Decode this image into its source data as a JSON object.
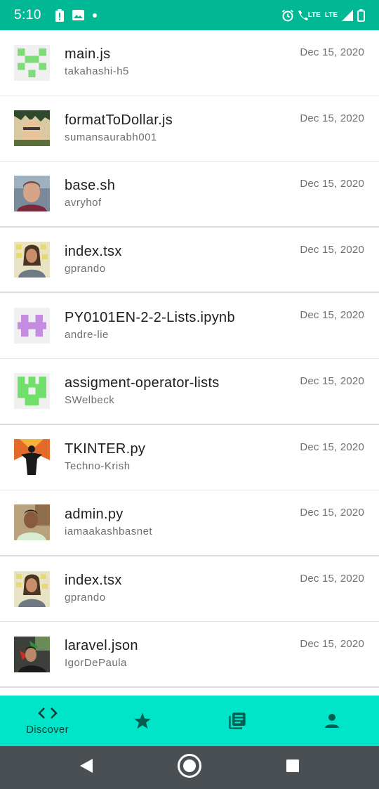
{
  "status_bar": {
    "time": "5:10",
    "left_icons": [
      "battery-alert-icon",
      "image-icon",
      "dot-icon"
    ],
    "right_icons": [
      "alarm-icon",
      "wifi-calling-lte-icon",
      "lte-icon",
      "signal-icon",
      "battery-icon"
    ],
    "lte_label": "LTE",
    "lte_label_2": "LTE"
  },
  "gists": [
    {
      "file": "main.js",
      "user": "takahashi-h5",
      "date": "Dec 15, 2020",
      "avatar": "identicon-green-x"
    },
    {
      "file": "formatToDollar.js",
      "user": "sumansaurabh001",
      "date": "Dec 15, 2020",
      "avatar": "photo-anime"
    },
    {
      "file": "base.sh",
      "user": "avryhof",
      "date": "Dec 15, 2020",
      "avatar": "photo-man"
    },
    {
      "file": "index.tsx",
      "user": "gprando",
      "date": "Dec 15, 2020",
      "avatar": "photo-longhair"
    },
    {
      "file": "PY0101EN-2-2-Lists.ipynb",
      "user": "andre-lie",
      "date": "Dec 15, 2020",
      "avatar": "identicon-purple"
    },
    {
      "file": "assigment-operator-lists",
      "user": "SWelbeck",
      "date": "Dec 15, 2020",
      "avatar": "identicon-green-block"
    },
    {
      "file": "TKINTER.py",
      "user": "Techno-Krish",
      "date": "Dec 15, 2020",
      "avatar": "photo-silhouette"
    },
    {
      "file": "admin.py",
      "user": "iamaakashbasnet",
      "date": "Dec 15, 2020",
      "avatar": "photo-boy"
    },
    {
      "file": "index.tsx",
      "user": "gprando",
      "date": "Dec 15, 2020",
      "avatar": "photo-longhair"
    },
    {
      "file": "laravel.json",
      "user": "IgorDePaula",
      "date": "Dec 15, 2020",
      "avatar": "photo-flag"
    }
  ],
  "bottom_nav": {
    "items": [
      {
        "label": "Discover",
        "icon": "code-icon",
        "active": true
      },
      {
        "label": "",
        "icon": "star-icon",
        "active": false
      },
      {
        "label": "",
        "icon": "library-icon",
        "active": false
      },
      {
        "label": "",
        "icon": "person-icon",
        "active": false
      }
    ]
  },
  "system_nav": [
    "back-icon",
    "home-icon",
    "recents-icon"
  ],
  "colors": {
    "status_bar": "#00b894",
    "bottom_nav": "#00e5c9",
    "nav_icon": "#035d52",
    "system_nav": "#4a4f54"
  }
}
